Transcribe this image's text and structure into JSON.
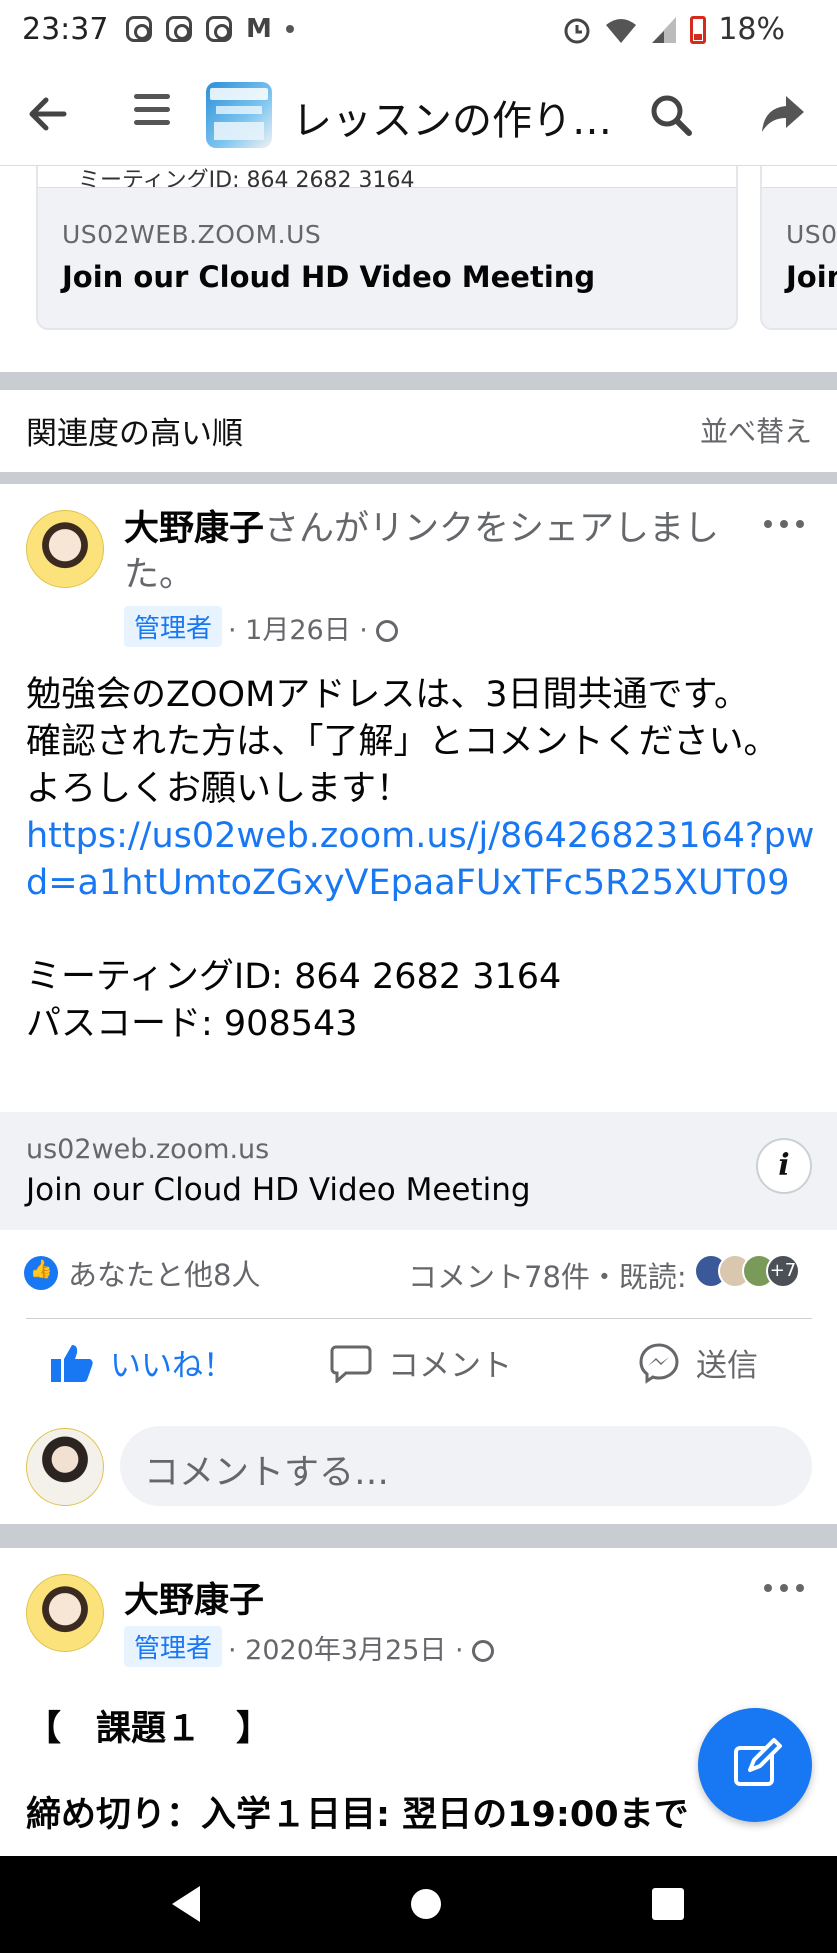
{
  "status_bar": {
    "time": "23:37",
    "battery": "18%",
    "icons": [
      "instagram-icon",
      "instagram-icon",
      "instagram-icon",
      "gmail-icon",
      "dot-icon",
      "alarm-icon",
      "wifi-icon",
      "signal-icon",
      "battery-icon"
    ]
  },
  "app_bar": {
    "title": "レッスンの作り…",
    "icons": [
      "back-arrow-icon",
      "menu-icon",
      "search-icon",
      "share-icon"
    ]
  },
  "top_cards": [
    {
      "cut_text": "ミーティングID: 864 2682 3164",
      "domain": "US02WEB.ZOOM.US",
      "title": "Join our Cloud HD Video Meeting"
    },
    {
      "cut_text": "",
      "domain": "US0",
      "title": "Join"
    }
  ],
  "sort": {
    "label": "関連度の高い順",
    "button": "並べ替え"
  },
  "post1": {
    "author": "大野康子",
    "action": "さんがリンクをシェアしました。",
    "badge": "管理者",
    "date": "· 1月26日 ·",
    "lines": [
      "勉強会のZOOMアドレスは、3日間共通です。",
      "確認された方は、「了解」とコメントください。",
      "よろしくお願いします！"
    ],
    "url": "https://us02web.zoom.us/j/86426823164?pwd=a1htUmtoZGxyVEpaaFUxTFc5R25XUT09",
    "meeting_id": "ミーティングID: 864 2682 3164",
    "passcode": "パスコード: 908543",
    "preview": {
      "domain": "us02web.zoom.us",
      "title": "Join our Cloud HD Video Meeting",
      "info": "i"
    },
    "reactions": "あなたと他8人",
    "comments": "コメント78件・既読:",
    "seen_more": "+7",
    "actions": {
      "like": "いいね！",
      "comment": "コメント",
      "send": "送信"
    },
    "composer_placeholder": "コメントする…"
  },
  "post2": {
    "author": "大野康子",
    "badge": "管理者",
    "date": "· 2020年3月25日 ·",
    "line1": "【　課題１　】",
    "line2": "締め切り：入学１日目: 翌日の19:00まで"
  },
  "colors": {
    "accent": "#1877f2",
    "secondary_text": "#65676b",
    "divider": "#c9ccd1"
  }
}
